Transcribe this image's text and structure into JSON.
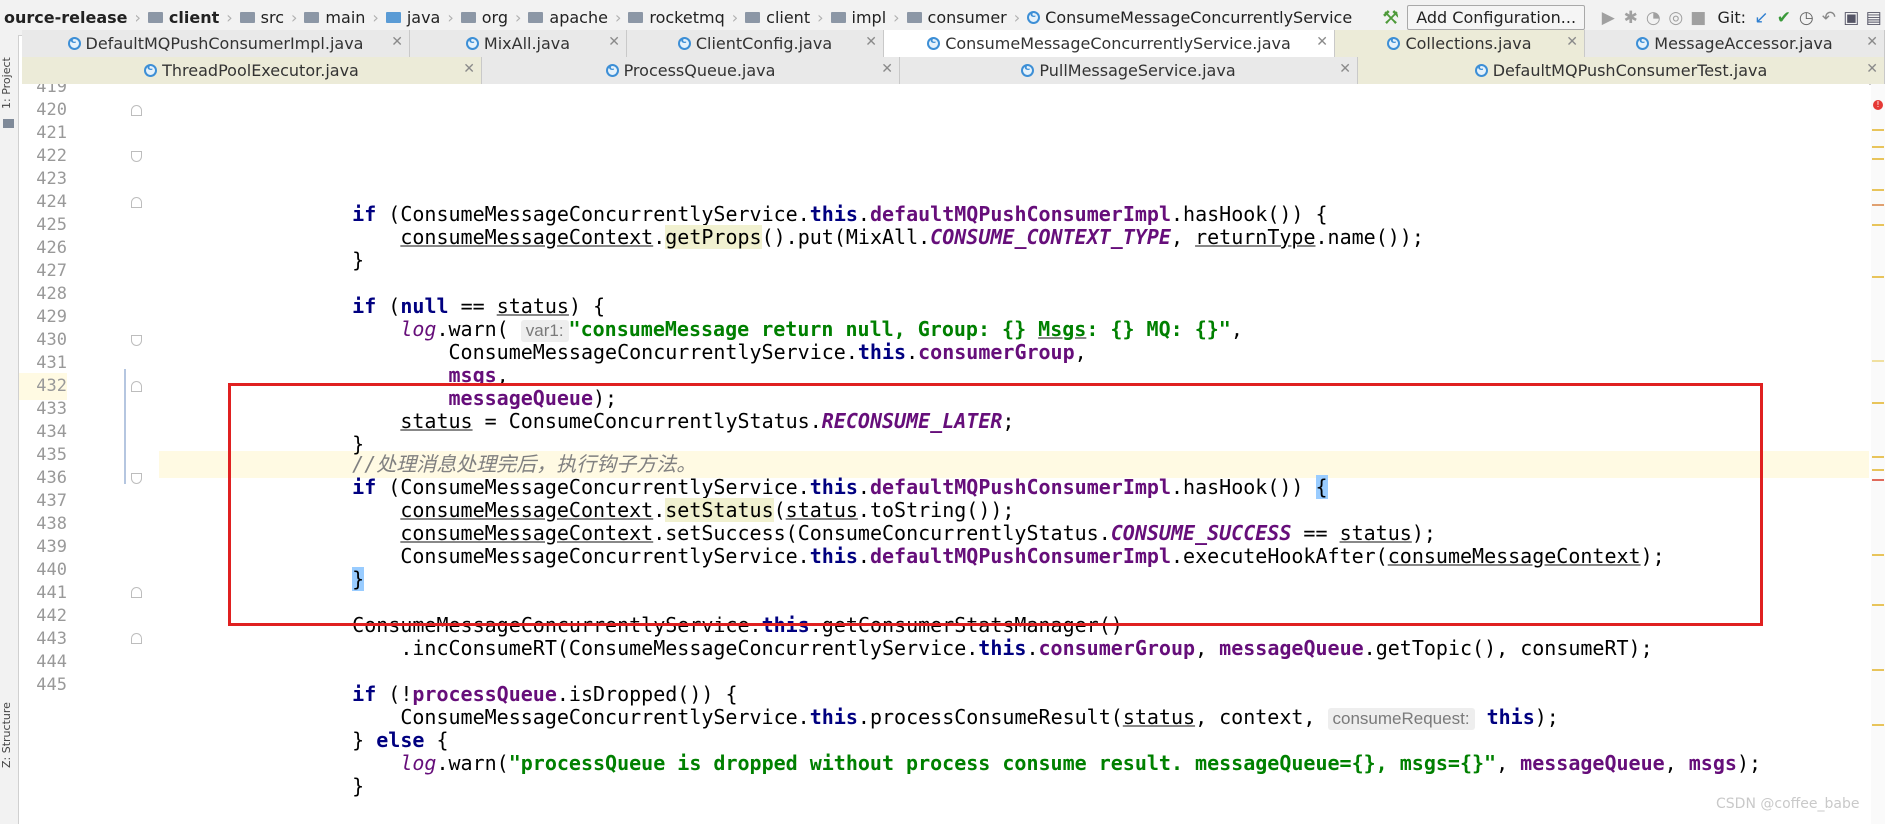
{
  "breadcrumb": {
    "items": [
      {
        "label": "ource-release",
        "icon": "none"
      },
      {
        "label": "client",
        "icon": "module-folder-icon"
      },
      {
        "label": "src",
        "icon": "folder-icon"
      },
      {
        "label": "main",
        "icon": "folder-icon"
      },
      {
        "label": "java",
        "icon": "source-folder-icon"
      },
      {
        "label": "org",
        "icon": "package-icon"
      },
      {
        "label": "apache",
        "icon": "package-icon"
      },
      {
        "label": "rocketmq",
        "icon": "package-icon"
      },
      {
        "label": "client",
        "icon": "package-icon"
      },
      {
        "label": "impl",
        "icon": "package-icon"
      },
      {
        "label": "consumer",
        "icon": "package-icon"
      },
      {
        "label": "ConsumeMessageConcurrentlyService",
        "icon": "class-icon"
      }
    ]
  },
  "toolbar": {
    "add_configuration_label": "Add Configuration...",
    "git_label": "Git:"
  },
  "tabs_row1": [
    {
      "label": "DefaultMQPushConsumerImpl.java",
      "active": false
    },
    {
      "label": "MixAll.java",
      "active": false
    },
    {
      "label": "ClientConfig.java",
      "active": false
    },
    {
      "label": "ConsumeMessageConcurrentlyService.java",
      "active": true
    },
    {
      "label": "Collections.java",
      "active": false
    },
    {
      "label": "MessageAccessor.java",
      "active": false
    }
  ],
  "tabs_row2": [
    {
      "label": "ThreadPoolExecutor.java"
    },
    {
      "label": "ProcessQueue.java"
    },
    {
      "label": "PullMessageService.java"
    },
    {
      "label": "DefaultMQPushConsumerTest.java"
    }
  ],
  "side_panels": {
    "project_label": "1: Project",
    "structure_label": "Z: Structure"
  },
  "editor": {
    "line_numbers": [
      "419",
      "420",
      "421",
      "422",
      "423",
      "424",
      "425",
      "426",
      "427",
      "428",
      "429",
      "430",
      "431",
      "432",
      "433",
      "434",
      "435",
      "436",
      "437",
      "438",
      "439",
      "440",
      "441",
      "442",
      "443",
      "444",
      "445"
    ],
    "current_line": "432",
    "annotated_comment": "//处理消息处理完后，执行钩子方法。",
    "hint_var1": "var1:",
    "hint_consume_request": "consumeRequest:"
  },
  "watermark": "CSDN @coffee_babe",
  "colors": {
    "keyword": "#000080",
    "field": "#660e7a",
    "string": "#008000",
    "comment": "#808080",
    "annotation_box": "#e02020",
    "current_line_bg": "#fffae3"
  }
}
